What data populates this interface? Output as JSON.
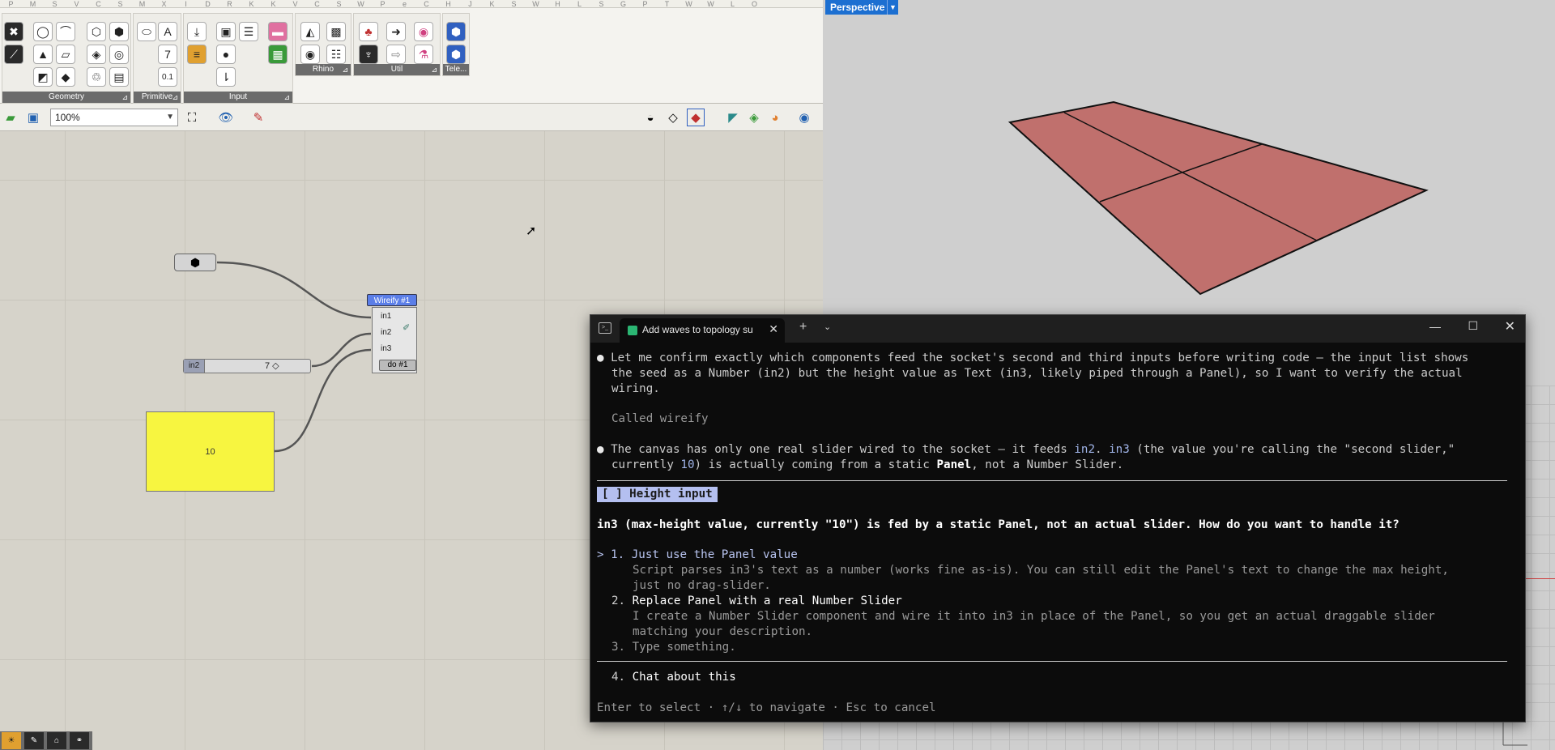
{
  "grasshopper": {
    "letter_bar": [
      "P",
      "M",
      "S",
      "V",
      "C",
      "S",
      "M",
      "X",
      "I",
      "D",
      "R",
      "K",
      "K",
      "V",
      "C",
      "S",
      "W",
      "P",
      "e",
      "C",
      "H",
      "J",
      "K",
      "S",
      "W",
      "H",
      "L",
      "S",
      "G",
      "P",
      "T",
      "W",
      "W",
      "L",
      "O"
    ],
    "ribbon_groups": [
      {
        "label": "Geometry"
      },
      {
        "label": "Primitive"
      },
      {
        "label": "Input"
      },
      {
        "label": "Rhino"
      },
      {
        "label": "Util"
      },
      {
        "label": "Tele..."
      }
    ],
    "zoom_value": "100%",
    "nodes": {
      "slider_label": "in2",
      "slider_value": "7",
      "panel_value": "10",
      "wireify_title": "Wireify #1",
      "ports": [
        "in1",
        "in2",
        "in3"
      ],
      "do_label": "do #1"
    }
  },
  "viewport": {
    "label": "Perspective"
  },
  "terminal": {
    "tab_title": "Add waves to topology su",
    "lines": {
      "l1": "Let me confirm exactly which components feed the socket's second and third inputs before writing code — the input list shows",
      "l2": "the seed as a Number (in2) but the height value as Text (in3, likely piped through a Panel), so I want to verify the actual",
      "l3": "wiring.",
      "called": "Called wireify",
      "m1a": "The canvas has only one real slider wired to the socket — it feeds ",
      "m1b": "in2",
      "m1c": ". ",
      "m1d": "in3",
      "m1e": " (the value you're calling the \"second slider,\"",
      "m2a": "currently ",
      "m2b": "10",
      "m2c": ") is actually coming from a static ",
      "m2d": "Panel",
      "m2e": ", not a Number Slider."
    },
    "question_header": "[ ] Height input",
    "question": "in3 (max-height value, currently \"10\") is fed by a static Panel, not an actual slider. How do you want to handle it?",
    "options": [
      {
        "num": "1.",
        "label": "Just use the Panel value",
        "desc1": "Script parses in3's text as a number (works fine as-is). You can still edit the Panel's text to change the max height,",
        "desc2": "just no drag-slider."
      },
      {
        "num": "2.",
        "label": "Replace Panel with a real Number Slider",
        "desc1": "I create a Number Slider component and wire it into in3 in place of the Panel, so you get an actual draggable slider",
        "desc2": "matching your description."
      },
      {
        "num": "3.",
        "label": "Type something."
      },
      {
        "num": "4.",
        "label": "Chat about this"
      }
    ],
    "footer": "Enter to select · ↑/↓ to navigate · Esc to cancel"
  }
}
